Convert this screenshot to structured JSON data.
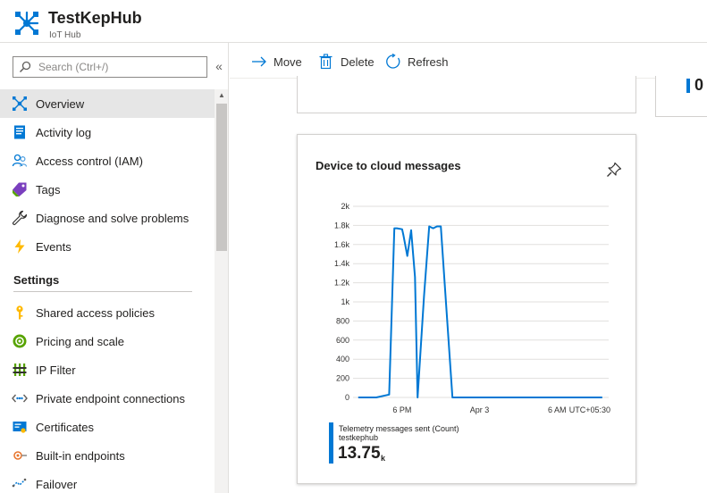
{
  "header": {
    "title": "TestKepHub",
    "subtitle": "IoT Hub"
  },
  "search": {
    "placeholder": "Search (Ctrl+/)",
    "value": "",
    "collapse_label": "«"
  },
  "sidebar": {
    "items": [
      {
        "label": "Overview",
        "icon": "iot-hub-overview-icon",
        "selected": true
      },
      {
        "label": "Activity log",
        "icon": "activity-log-icon"
      },
      {
        "label": "Access control (IAM)",
        "icon": "access-control-icon"
      },
      {
        "label": "Tags",
        "icon": "tag-icon"
      },
      {
        "label": "Diagnose and solve problems",
        "icon": "wrench-icon"
      },
      {
        "label": "Events",
        "icon": "lightning-icon"
      }
    ],
    "settings_header": "Settings",
    "settings_items": [
      {
        "label": "Shared access policies",
        "icon": "key-icon"
      },
      {
        "label": "Pricing and scale",
        "icon": "pricing-icon"
      },
      {
        "label": "IP Filter",
        "icon": "ip-filter-icon"
      },
      {
        "label": "Private endpoint connections",
        "icon": "private-endpoint-icon"
      },
      {
        "label": "Certificates",
        "icon": "certificate-icon"
      },
      {
        "label": "Built-in endpoints",
        "icon": "endpoint-icon"
      },
      {
        "label": "Failover",
        "icon": "failover-icon"
      }
    ]
  },
  "toolbar": {
    "move_label": "Move",
    "delete_label": "Delete",
    "refresh_label": "Refresh"
  },
  "top_cards": {
    "right_value": "0"
  },
  "chart_card": {
    "title": "Device to cloud messages"
  },
  "chart_data": {
    "type": "line",
    "title": "Device to cloud messages",
    "xlabel": "",
    "ylabel": "",
    "ylim": [
      0,
      2000
    ],
    "yticks": [
      {
        "value": 0,
        "label": "0"
      },
      {
        "value": 200,
        "label": "200"
      },
      {
        "value": 400,
        "label": "400"
      },
      {
        "value": 600,
        "label": "600"
      },
      {
        "value": 800,
        "label": "800"
      },
      {
        "value": 1000,
        "label": "1k"
      },
      {
        "value": 1200,
        "label": "1.2k"
      },
      {
        "value": 1400,
        "label": "1.4k"
      },
      {
        "value": 1600,
        "label": "1.6k"
      },
      {
        "value": 1800,
        "label": "1.8k"
      },
      {
        "value": 2000,
        "label": "2k"
      }
    ],
    "xrange_hours": [
      14.2,
      34.0
    ],
    "xticks": [
      {
        "hour": 18,
        "label": "6 PM"
      },
      {
        "hour": 24,
        "label": "Apr 3"
      },
      {
        "hour": 30,
        "label": "6 AM"
      }
    ],
    "timezone_label": "UTC+05:30",
    "grid": true,
    "series": [
      {
        "name": "Telemetry messages sent (Count)",
        "color": "#0078d4",
        "x_hours": [
          14.6,
          16.0,
          17.0,
          17.4,
          17.6,
          18.0,
          18.1,
          18.4,
          18.7,
          19.0,
          19.2,
          19.7,
          20.1,
          20.4,
          20.7,
          21.0,
          21.3,
          21.9,
          22.3,
          33.5
        ],
        "values": [
          0,
          0,
          30,
          1770,
          1770,
          1760,
          1700,
          1480,
          1750,
          1260,
          0,
          1060,
          1790,
          1770,
          1790,
          1790,
          1180,
          0,
          0,
          0
        ]
      }
    ]
  },
  "legend": {
    "series_name": "Telemetry messages sent (Count)",
    "resource": "testkephub",
    "total_value": "13.75",
    "total_unit": "k"
  },
  "colors": {
    "accent": "#0078d4",
    "selected_bg": "#e6e6e6"
  }
}
